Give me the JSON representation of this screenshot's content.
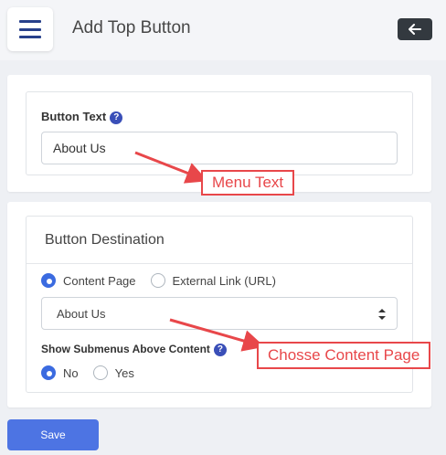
{
  "header": {
    "title": "Add Top Button",
    "menu_icon": "hamburger-icon",
    "back_icon": "arrow-left-icon"
  },
  "button_text_card": {
    "label": "Button Text",
    "help": "?",
    "value": "About Us"
  },
  "destination_card": {
    "title": "Button Destination",
    "options": [
      {
        "label": "Content Page",
        "checked": true
      },
      {
        "label": "External Link (URL)",
        "checked": false
      }
    ],
    "selected_page": "About Us",
    "submenus_label": "Show Submenus Above Content",
    "help": "?",
    "submenu_options": [
      {
        "label": "No",
        "checked": true
      },
      {
        "label": "Yes",
        "checked": false
      }
    ]
  },
  "save_label": "Save",
  "annotations": {
    "menu_text": "Menu Text",
    "content_page": "Chosse Content Page"
  },
  "colors": {
    "accent": "#3b6be0",
    "annotation": "#e8474a",
    "save": "#4d74e3"
  }
}
